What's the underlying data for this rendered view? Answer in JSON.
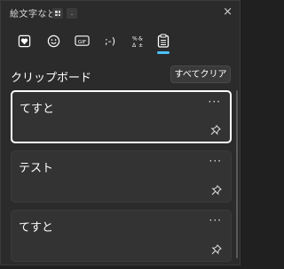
{
  "window": {
    "title": "絵文字など",
    "shortcut_dot": ".",
    "close_glyph": "×"
  },
  "tabs": [
    {
      "icon": "heart-sticker-icon",
      "selected": false
    },
    {
      "icon": "emoji-icon",
      "selected": false
    },
    {
      "icon": "gif-icon",
      "label": "GIF",
      "selected": false
    },
    {
      "icon": "kaomoji-icon",
      "label": ";-)",
      "selected": false
    },
    {
      "icon": "symbols-icon",
      "selected": false
    },
    {
      "icon": "clipboard-icon",
      "selected": true
    }
  ],
  "clipboard": {
    "title": "クリップボード",
    "clear_all_label": "すべてクリア",
    "items": [
      {
        "text": "てすと",
        "selected": true
      },
      {
        "text": "テスト",
        "selected": false
      },
      {
        "text": "てすと",
        "selected": false
      }
    ],
    "more_glyph": "···"
  },
  "colors": {
    "accent": "#4cc2ff",
    "panel_bg": "#2b2b2b",
    "card_bg": "#333333"
  }
}
